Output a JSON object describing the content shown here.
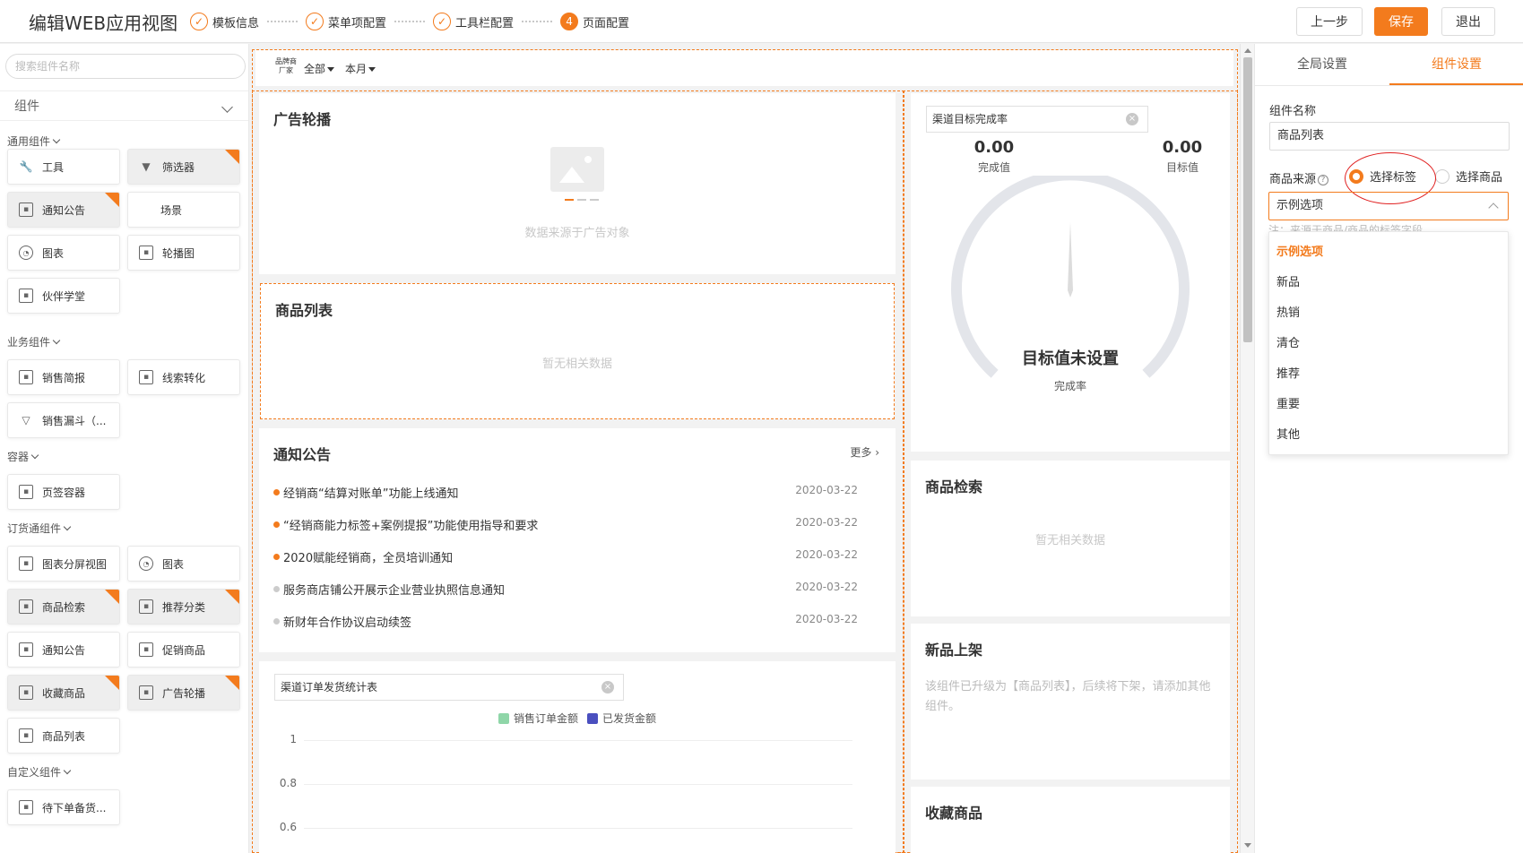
{
  "header": {
    "title": "编辑WEB应用视图",
    "steps": [
      {
        "icon": "✓",
        "label": "模板信息"
      },
      {
        "icon": "✓",
        "label": "菜单项配置"
      },
      {
        "icon": "✓",
        "label": "工具栏配置"
      },
      {
        "icon": "4",
        "label": "页面配置"
      }
    ],
    "prev_label": "上一步",
    "save_label": "保存",
    "exit_label": "退出"
  },
  "left": {
    "search_placeholder": "搜索组件名称",
    "select_label": "组件",
    "groups": {
      "general": "通用组件",
      "business": "业务组件",
      "container": "容器",
      "ordering": "订货通组件",
      "custom": "自定义组件"
    },
    "items": {
      "tool": "工具",
      "filter": "筛选器",
      "notice": "通知公告",
      "scene": "场景",
      "chart": "图表",
      "carousel": "轮播图",
      "partner": "伙伴学堂",
      "sales_report": "销售简报",
      "lead_conv": "线索转化",
      "funnel": "销售漏斗（...",
      "tab_container": "页签容器",
      "chart_split": "图表分屏视图",
      "chart2": "图表",
      "product_search": "商品检索",
      "recommend": "推荐分类",
      "notice2": "通知公告",
      "promo": "促销商品",
      "favorites": "收藏商品",
      "ad_carousel": "广告轮播",
      "product_list": "商品列表",
      "pending": "待下单备货..."
    }
  },
  "canvas": {
    "filterbar": {
      "brand": "品牌商 厂家",
      "all": "全部",
      "month": "本月"
    },
    "ad": {
      "title": "广告轮播",
      "empty": "数据来源于广告对象"
    },
    "product_list": {
      "title": "商品列表",
      "empty": "暂无相关数据"
    },
    "notice": {
      "title": "通知公告",
      "more": "更多",
      "rows": [
        {
          "text": "经销商“结算对账单”功能上线通知",
          "date": "2020-03-22"
        },
        {
          "text": "“经销商能力标签+案例提报”功能使用指导和要求",
          "date": "2020-03-22"
        },
        {
          "text": "2020赋能经销商，全员培训通知",
          "date": "2020-03-22"
        },
        {
          "text": "服务商店铺公开展示企业营业执照信息通知",
          "date": "2020-03-22"
        },
        {
          "text": "新财年合作协议启动续签",
          "date": "2020-03-22"
        }
      ]
    },
    "order_chart": {
      "select_value": "渠道订单发货统计表",
      "clear": "×",
      "legend": [
        {
          "name": "销售订单金额",
          "color": "#8fd6a8"
        },
        {
          "name": "已发货金额",
          "color": "#4a4fbf"
        }
      ],
      "yticks": [
        "1",
        "0.8",
        "0.6"
      ]
    },
    "gauge": {
      "select_value": "渠道目标完成率",
      "clear": "×",
      "done_value": "0.00",
      "done_label": "完成值",
      "target_value": "0.00",
      "target_label": "目标值",
      "center_title": "目标值未设置",
      "center_sub": "完成率"
    },
    "product_search": {
      "title": "商品检索",
      "empty": "暂无相关数据"
    },
    "new_arrivals": {
      "title": "新品上架",
      "note": "该组件已升级为【商品列表】，后续将下架，请添加其他组件。"
    },
    "favorites": {
      "title": "收藏商品"
    }
  },
  "right": {
    "tab_global": "全局设置",
    "tab_component": "组件设置",
    "name_label": "组件名称",
    "name_value": "商品列表",
    "source_label": "商品来源",
    "help": "?",
    "radio_tag": "选择标签",
    "radio_product": "选择商品",
    "select_value": "示例选项",
    "hint": "注：来源于商品/商品的标签字段",
    "options": [
      "示例选项",
      "新品",
      "热销",
      "清仓",
      "推荐",
      "重要",
      "其他"
    ]
  },
  "colors": {
    "accent": "#f37b1d",
    "annotation": "#e02020"
  }
}
